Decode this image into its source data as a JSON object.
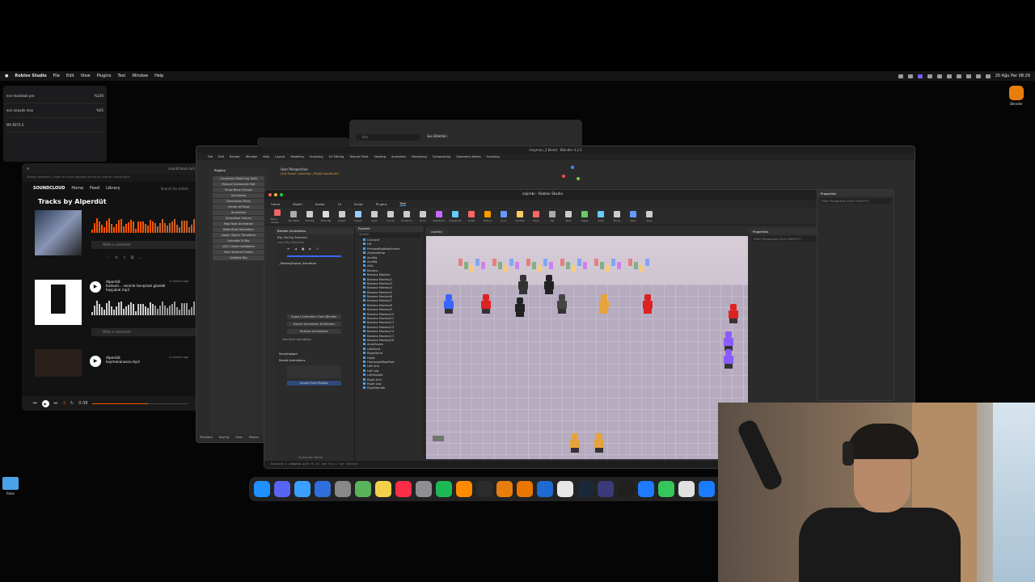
{
  "menubar": {
    "app_name": "Roblox Studio",
    "items": [
      "File",
      "Edit",
      "View",
      "Plugins",
      "Test",
      "Window",
      "Help"
    ],
    "datetime": "20 Ağu Per 08:29"
  },
  "audio_popover": {
    "devices": [
      {
        "name": "ece macbook pro",
        "value": "%100"
      },
      {
        "name": "ece airpods max",
        "value": "%95"
      },
      {
        "name": "MX KEYS S",
        "value": ""
      }
    ]
  },
  "soundcloud": {
    "brand": "SOUNDCLOUD",
    "nav": [
      "Home",
      "Feed",
      "Library"
    ],
    "search_placeholder": "Search for artists",
    "address": "Stream Alperdüt | Listen to music playlists online for free on SoundCloud",
    "domain": "soundcloud.com",
    "page_title": "Tracks by Alperdüt",
    "comment_placeholder": "Write a comment",
    "tracks": [
      {
        "artist": "Alperdüt",
        "title": "kaskum... seninle tanışmak güzeldi hoşçakal.mp3",
        "age": "4 months ago"
      },
      {
        "artist": "Alperdüt",
        "title": "kaymananasss.mp3",
        "age": "4 months ago"
      }
    ],
    "player_time": "0:39",
    "player_progress": 0.58
  },
  "blender": {
    "title": "maymun_3.blend - Blender 4.2.1",
    "menu": [
      "File",
      "Edit",
      "Render",
      "Window",
      "Help",
      "Layout",
      "Modeling",
      "Sculpting",
      "UV Editing",
      "Texture Paint",
      "Shading",
      "Animation",
      "Rendering",
      "Compositing",
      "Geometry Nodes",
      "Scripting"
    ],
    "viewport_label": "User Perspective",
    "viewport_sub": "(43) Scene Collection | Right.handle.001",
    "left_section": "Rigging",
    "left_buttons": [
      "Constraint Matching Tools",
      "Manual Constraint Edit",
      "Show Bone Groups",
      "Get Bones",
      "Dimension Mesh",
      "Center of Mass",
      "Animation",
      "Animation Source",
      "Map Root Animation",
      "Bake Root Animation",
      "Apply Object Transform",
      "Animate To Rig",
      "UGC Create Validation",
      "Max Vertices Frame",
      "Validate Rig"
    ],
    "bottom": [
      "Playback",
      "Keying",
      "View",
      "Marker"
    ]
  },
  "finder_popup": {
    "search_placeholder": "Ara",
    "item": "Ses Efektleri"
  },
  "roblox": {
    "title": "cojimbi - Roblox Studio",
    "tabs": [
      "Home",
      "Model",
      "Avatar",
      "UI",
      "Script",
      "Plugins",
      "Test"
    ],
    "active_tab": "Test",
    "ribbon": [
      "Move Arrows",
      "Clip Editor",
      "Edit Rig",
      "Build Rig",
      "Import",
      "Export",
      "Paint",
      "Curves",
      "Transform",
      "Point",
      "Keyframes",
      "Dopesheet",
      "Graph",
      "Texture",
      "Anim",
      "Fix Pose",
      "Bone",
      "Rig",
      "Weld",
      "Toggle",
      "Scale",
      "Studio",
      "Track",
      "Save"
    ],
    "anim_panel": {
      "title": "Blender Animations",
      "rig_label": "Rig: No Rig Selected",
      "selection": "Load Rig Selection",
      "armature": "_MonkeyExport_Armature",
      "buttons": [
        "Import Animation From Blender",
        "Export Animation To Blender",
        "Refresh Animations"
      ],
      "sync": "Use Sync Animation",
      "saves_header": "Save/Upload",
      "saved_header": "Saved Animations",
      "import_button": "Import From Roblox",
      "footer": "Animation Name"
    },
    "explorer": {
      "title": "Explorer",
      "search": "Search",
      "items": [
        "Concord",
        "Hit",
        "PreviewRigAttachment",
        "ZombieDrop",
        "AceRig",
        "AceRig",
        "Alb1",
        "Banana",
        "Banana Monkey",
        "Banana Monkey2",
        "Banana Monkey3",
        "Banana Monkey4",
        "Banana Monkey5",
        "Banana Monkey6",
        "Banana Monkey7",
        "Banana Monkey8",
        "Banana Monkey9",
        "Banana Monkey10",
        "Banana Monkey11",
        "Banana Monkey12",
        "Banana Monkey13",
        "Banana Monkey14",
        "Banana Monkey15",
        "Banana Monkey16",
        "AnimSaves",
        "LeftHand",
        "RightHand",
        "Head",
        "HumanoidRootPart",
        "Left Arm",
        "Left Leg",
        "LeftHandle",
        "Right Arm",
        "Right Leg",
        "RightHandle"
      ]
    },
    "viewport_tab": "cojimbi",
    "hud_counter": "250",
    "properties": {
      "title": "Properties",
      "filter": "Filter Properties (Ctrl+Shift+P)"
    },
    "command_bar": "Execute a command with ⌘+ or use ⌘+↑/↓ for history"
  },
  "props_right": {
    "title": "Properties",
    "filter": "Filter Properties (Ctrl+Shift+P)"
  },
  "desktop": {
    "blender_icon_label": "Blender",
    "folder_label": "fotos"
  },
  "dock": {
    "apps": [
      {
        "icon": "finder-icon",
        "color": "#1e90ff"
      },
      {
        "icon": "discord-icon",
        "color": "#5865f2"
      },
      {
        "icon": "safari-icon",
        "color": "#3aa0ff"
      },
      {
        "icon": "xcode-icon",
        "color": "#2f6fdc"
      },
      {
        "icon": "launchpad-icon",
        "color": "#888888"
      },
      {
        "icon": "maps-icon",
        "color": "#58b35a"
      },
      {
        "icon": "notes-icon",
        "color": "#f3d04a"
      },
      {
        "icon": "music-icon",
        "color": "#fa2d48"
      },
      {
        "icon": "settings-icon",
        "color": "#8e8e93"
      },
      {
        "icon": "spotify-icon",
        "color": "#1db954"
      },
      {
        "icon": "sublime-icon",
        "color": "#ff8a00"
      },
      {
        "icon": "activity-icon",
        "color": "#2c2c2c"
      },
      {
        "icon": "blender-icon",
        "color": "#e87d0d"
      },
      {
        "icon": "blender2-icon",
        "color": "#ea7600"
      },
      {
        "icon": "quicktime-icon",
        "color": "#1f6ad1"
      },
      {
        "icon": "altool-icon",
        "color": "#e7e7e7"
      },
      {
        "icon": "steam-icon",
        "color": "#1b2838"
      },
      {
        "icon": "obs-icon",
        "color": "#3a3a7a"
      },
      {
        "icon": "clapper-icon",
        "color": "#202020"
      },
      {
        "icon": "roblox-studio-icon",
        "color": "#1e7bff"
      },
      {
        "icon": "numbers-icon",
        "color": "#35c759"
      },
      {
        "icon": "roblox-icon",
        "color": "#e0e0e0"
      },
      {
        "icon": "appstore-icon",
        "color": "#1a7cff"
      }
    ]
  }
}
